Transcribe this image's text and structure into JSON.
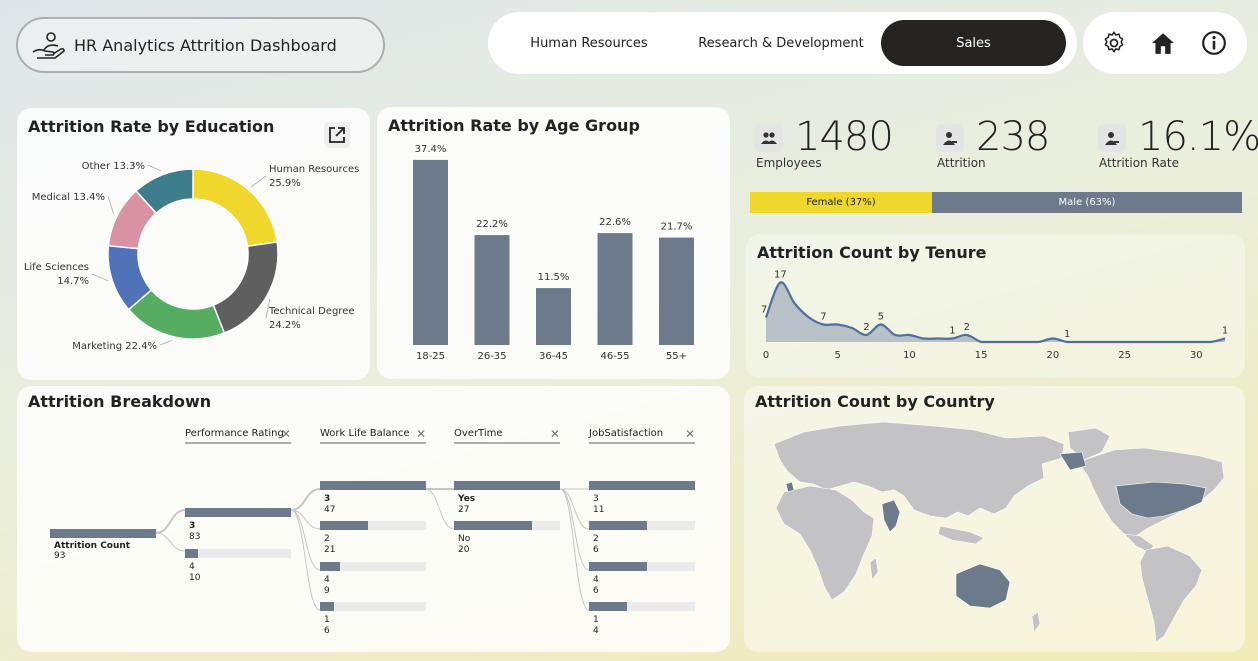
{
  "header": {
    "title": "HR Analytics Attrition Dashboard",
    "tabs": [
      {
        "label": "Human Resources",
        "active": false
      },
      {
        "label": "Research & Development",
        "active": false
      },
      {
        "label": "Sales",
        "active": true
      }
    ],
    "icons": [
      "settings-icon",
      "home-icon",
      "info-icon"
    ]
  },
  "kpis": [
    {
      "value": "1480",
      "label": "Employees",
      "icon": "people-icon"
    },
    {
      "value": "238",
      "label": "Attrition",
      "icon": "user-exit-icon"
    },
    {
      "value": "16.1%",
      "label": "Attrition Rate",
      "icon": "user-exit-icon"
    }
  ],
  "gender": {
    "female_label": "Female (37%)",
    "male_label": "Male (63%)",
    "female_pct": 37,
    "male_pct": 63
  },
  "colors": {
    "slate": "#6c7a8c",
    "yellow": "#f0d72c",
    "dark": "#252423"
  },
  "chart_data": [
    {
      "type": "pie",
      "title": "Attrition Rate by Education",
      "donut": true,
      "categories": [
        "Human Resources",
        "Technical Degree",
        "Marketing",
        "Life Sciences",
        "Medical",
        "Other"
      ],
      "values": [
        25.9,
        24.2,
        22.4,
        14.7,
        13.4,
        13.3
      ],
      "labels": [
        "25.9%",
        "24.2%",
        "22.4%",
        "14.7%",
        "13.4%",
        "13.3%"
      ],
      "colors": [
        "#f0d72c",
        "#5f5f5f",
        "#56ad62",
        "#4f72b8",
        "#d992a2",
        "#3e7d8b"
      ]
    },
    {
      "type": "bar",
      "title": "Attrition Rate by Age Group",
      "categories": [
        "18-25",
        "26-35",
        "36-45",
        "46-55",
        "55+"
      ],
      "values": [
        37.4,
        22.2,
        11.5,
        22.6,
        21.7
      ],
      "labels": [
        "37.4%",
        "22.2%",
        "11.5%",
        "22.6%",
        "21.7%"
      ],
      "ylim": [
        0,
        40
      ]
    },
    {
      "type": "area",
      "title": "Attrition Count by Tenure",
      "x": [
        0,
        1,
        2,
        3,
        4,
        5,
        6,
        7,
        8,
        9,
        10,
        11,
        12,
        13,
        14,
        15,
        16,
        17,
        18,
        19,
        20,
        21,
        22,
        23,
        24,
        25,
        26,
        27,
        28,
        29,
        30,
        31,
        32
      ],
      "values": [
        7,
        17,
        11,
        7,
        5,
        5,
        4,
        2,
        5,
        2,
        2,
        1,
        1,
        1,
        2,
        0,
        0,
        0,
        0,
        0,
        1,
        0,
        0,
        0,
        0,
        0,
        0,
        0,
        0,
        0,
        0,
        0,
        1
      ],
      "point_labels": [
        {
          "x": 0,
          "text": "7"
        },
        {
          "x": 1,
          "text": "17"
        },
        {
          "x": 4,
          "text": "7"
        },
        {
          "x": 7,
          "text": "2"
        },
        {
          "x": 8,
          "text": "5"
        },
        {
          "x": 13,
          "text": "1"
        },
        {
          "x": 14,
          "text": "2"
        },
        {
          "x": 21,
          "text": "1"
        },
        {
          "x": 32,
          "text": "1"
        }
      ],
      "xticks": [
        0,
        5,
        10,
        15,
        20,
        25,
        30
      ],
      "xlim": [
        0,
        32
      ],
      "ylim": [
        0,
        20
      ]
    }
  ],
  "breakdown": {
    "title": "Attrition Breakdown",
    "root": {
      "label": "Attrition Count",
      "value": "93"
    },
    "columns": [
      {
        "name": "Performance Rating",
        "items": [
          {
            "label": "3",
            "value": "83",
            "frac": 1.0,
            "bold": true
          },
          {
            "label": "4",
            "value": "10",
            "frac": 0.12
          }
        ]
      },
      {
        "name": "Work Life Balance",
        "items": [
          {
            "label": "3",
            "value": "47",
            "frac": 1.0,
            "bold": true
          },
          {
            "label": "2",
            "value": "21",
            "frac": 0.45
          },
          {
            "label": "4",
            "value": "9",
            "frac": 0.19
          },
          {
            "label": "1",
            "value": "6",
            "frac": 0.13
          }
        ]
      },
      {
        "name": "OverTime",
        "items": [
          {
            "label": "Yes",
            "value": "27",
            "frac": 1.0,
            "bold": true
          },
          {
            "label": "No",
            "value": "20",
            "frac": 0.74
          }
        ]
      },
      {
        "name": "JobSatisfaction",
        "items": [
          {
            "label": "3",
            "value": "11",
            "frac": 1.0
          },
          {
            "label": "2",
            "value": "6",
            "frac": 0.55
          },
          {
            "label": "4",
            "value": "6",
            "frac": 0.55
          },
          {
            "label": "1",
            "value": "4",
            "frac": 0.36
          }
        ]
      }
    ]
  },
  "map": {
    "title": "Attrition Count by Country"
  }
}
